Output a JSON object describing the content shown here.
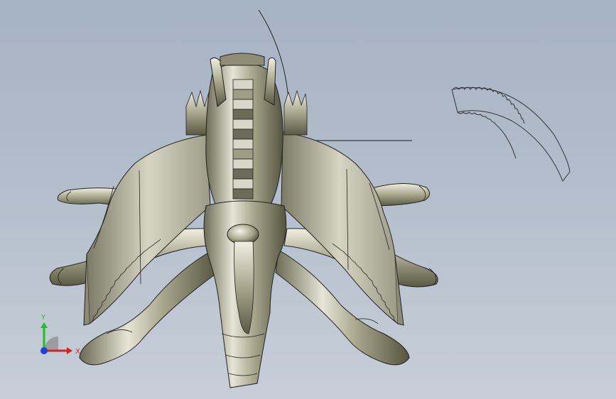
{
  "viewport": {
    "background_top": "#a6b3c4",
    "background_bottom": "#c7ced8"
  },
  "model": {
    "body_color": "#b9b79c",
    "edge_color": "#1a1a1a",
    "wing_color": "#c9c8b5"
  },
  "triad": {
    "x_label": "X",
    "y_label": "Y",
    "x_color": "#e02020",
    "y_color": "#20c020",
    "z_color": "#2040e0"
  }
}
